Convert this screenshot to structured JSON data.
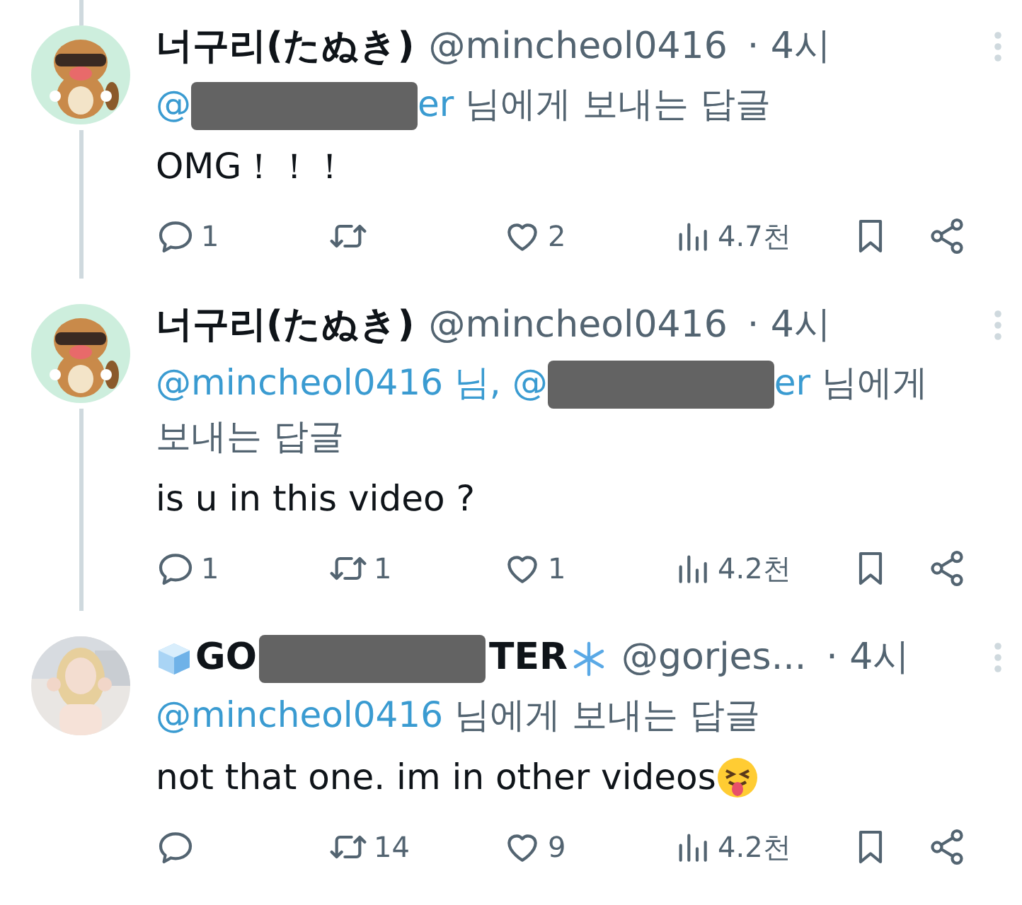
{
  "tweets": [
    {
      "avatar": {
        "kind": "picture"
      },
      "line_above": true,
      "line_below": true,
      "name": [
        {
          "kind": "text",
          "text": "너구리(たぬき)"
        }
      ],
      "handle": "@mincheol0416",
      "time": "· 4시",
      "reply_to": [
        {
          "kind": "mention",
          "text": "@"
        },
        {
          "kind": "redacted"
        },
        {
          "kind": "mention",
          "text": "er"
        },
        {
          "kind": "plain",
          "text": "님에게 보내는 답글"
        }
      ],
      "text": "OMG！！！",
      "text_emoji": false,
      "actions": {
        "replies": "1",
        "likes": "2",
        "views": "4.7천"
      }
    },
    {
      "avatar": {
        "kind": "picture"
      },
      "line_above": false,
      "line_below": true,
      "name": [
        {
          "kind": "text",
          "text": "너구리(たぬき)"
        }
      ],
      "handle": "@mincheol0416",
      "time": "· 4시",
      "reply_to": [
        {
          "kind": "mention",
          "text": "@mincheol0416 님, @"
        },
        {
          "kind": "redacted"
        },
        {
          "kind": "mention",
          "text": "er"
        },
        {
          "kind": "plain",
          "text": "님에게"
        },
        {
          "kind": "plain",
          "text": "보내는 답글"
        }
      ],
      "text": "is u in this video ?",
      "text_emoji": false,
      "actions": {
        "replies": "1",
        "retweets": "1",
        "likes": "1",
        "views": "4.2천"
      }
    },
    {
      "avatar": {
        "kind": "picture"
      },
      "line_above": false,
      "line_below": false,
      "name": [
        {
          "kind": "ice_cube"
        },
        {
          "kind": "text",
          "text": "GO"
        },
        {
          "kind": "redacted"
        },
        {
          "kind": "text",
          "text": "TER"
        },
        {
          "kind": "snowflake"
        }
      ],
      "handle": "@gorjes...",
      "time": "· 4시",
      "reply_to": [
        {
          "kind": "mention",
          "text": "@mincheol0416"
        },
        {
          "kind": "plain",
          "text": "님에게 보내는 답글"
        }
      ],
      "text": "not that one. im in other videos",
      "text_emoji": true,
      "actions": {
        "retweets": "14",
        "likes": "9",
        "views": "4.2천"
      }
    }
  ]
}
